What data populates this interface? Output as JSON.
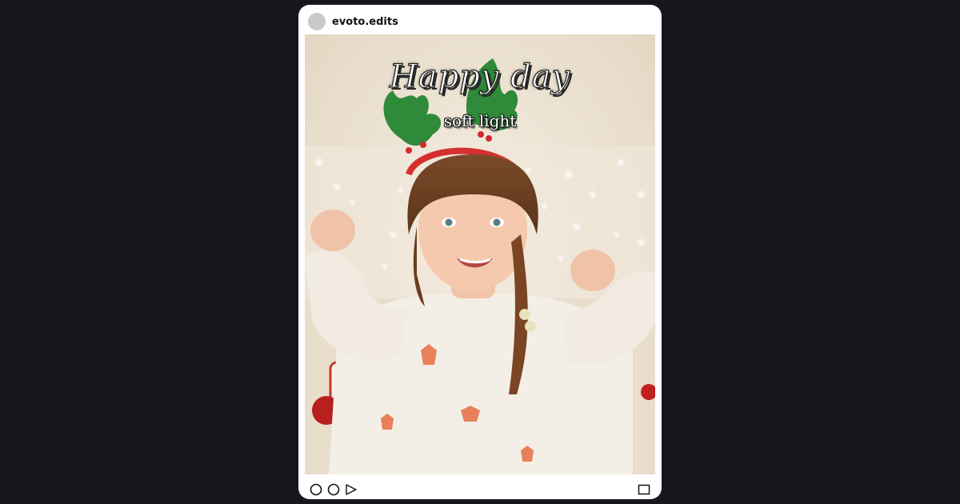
{
  "post": {
    "username": "evoto.edits",
    "caption": {
      "title": "Happy day",
      "subtitle": "soft light"
    },
    "image_description_icon": "photo-girl-holiday-headband",
    "footer_icons": [
      "like-icon",
      "comment-icon",
      "share-icon",
      "save-icon"
    ]
  },
  "colors": {
    "background": "#16171c",
    "card": "#ffffff",
    "avatar": "#c9c9c9"
  }
}
